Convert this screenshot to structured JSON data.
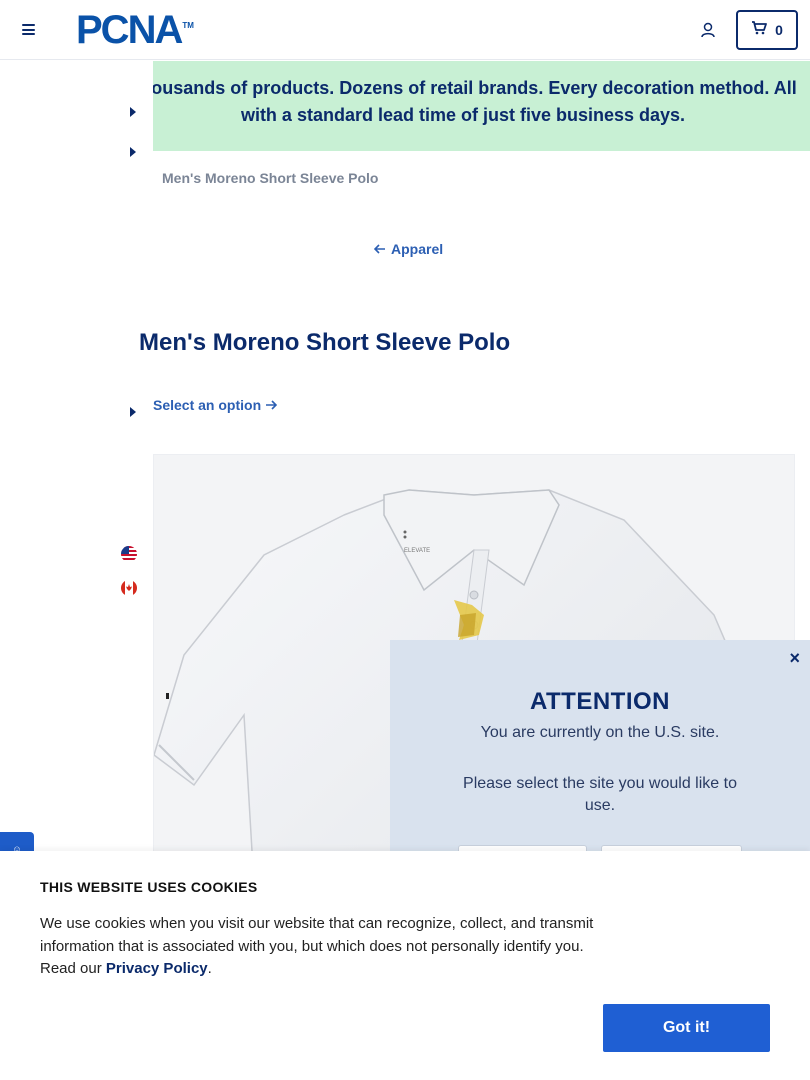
{
  "header": {
    "logo_text": "PCNA",
    "logo_tm": "TM",
    "cart_count": "0"
  },
  "promo": {
    "text": "Thousands of products. Dozens of retail brands. Every decoration method. All with a standard lead time of just five business days."
  },
  "breadcrumb": {
    "current": "Men's Moreno Short Sleeve Polo"
  },
  "back_link": {
    "label": "Apparel"
  },
  "product": {
    "title": "Men's Moreno Short Sleeve Polo",
    "option_link": "Select an option",
    "shirt_brand": "ELEVATE"
  },
  "modal": {
    "close": "×",
    "title": "ATTENTION",
    "line1": "You are currently on the U.S. site.",
    "line2": "Please select the site you would like to use."
  },
  "cookie": {
    "title": "THIS WEBSITE USES COOKIES",
    "body": "We use cookies when you visit our website that can recognize, collect, and transmit information that is associated with you, but which does not personally identify you. Read our",
    "link": "Privacy Policy",
    "period": ".",
    "button": "Got it!"
  },
  "colors": {
    "brand_blue": "#0a52a8",
    "navy": "#0b2a6b",
    "promo_green": "#c8f0d4",
    "button_blue": "#1f5fd3",
    "modal_bg": "#d9e2ee"
  },
  "icons": {
    "menu": "hamburger-icon",
    "account": "user-icon",
    "cart": "cart-icon",
    "us_flag": "us-flag-icon",
    "ca_flag": "canada-flag-icon"
  }
}
